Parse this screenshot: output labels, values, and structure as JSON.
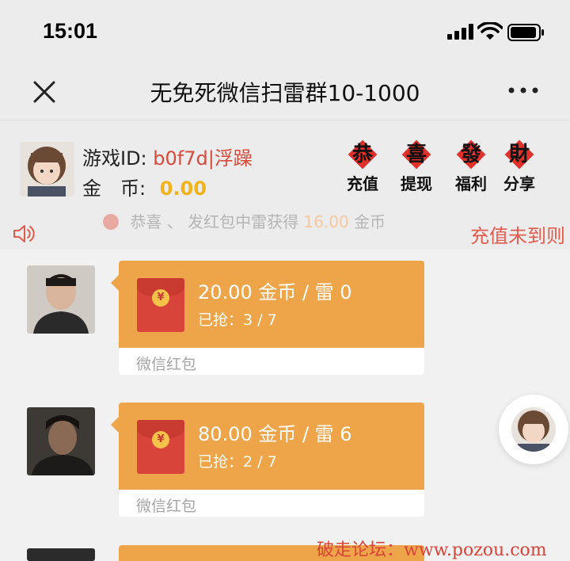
{
  "status_bar": {
    "time": "15:01"
  },
  "title_bar": {
    "title": "无免死微信扫雷群10-1000"
  },
  "profile": {
    "game_id_label": "游戏ID:",
    "game_id_value": "b0f7d|浮躁",
    "coin_label": "金　币:",
    "coin_value": "0.00"
  },
  "actions": [
    {
      "glyph": "恭",
      "label": "充值"
    },
    {
      "glyph": "喜",
      "label": "提现"
    },
    {
      "glyph": "發",
      "label": "福利"
    },
    {
      "glyph": "財",
      "label": "分享"
    }
  ],
  "notice": {
    "prefix": "恭喜 、 发红包中雷获得",
    "amount": "16.00",
    "suffix": "金币"
  },
  "marquee": "充值未到则",
  "messages": [
    {
      "amount": "20.00 金币 / 雷 0",
      "grabbed": "已抢：3 / 7",
      "kind": "微信红包"
    },
    {
      "amount": "80.00 金币 / 雷 6",
      "grabbed": "已抢：2 / 7",
      "kind": "微信红包"
    }
  ],
  "watermark": "破走论坛：www.pozou.com",
  "colors": {
    "accent_orange": "#eea448",
    "red": "#d8443a",
    "gold": "#f1b21a"
  }
}
